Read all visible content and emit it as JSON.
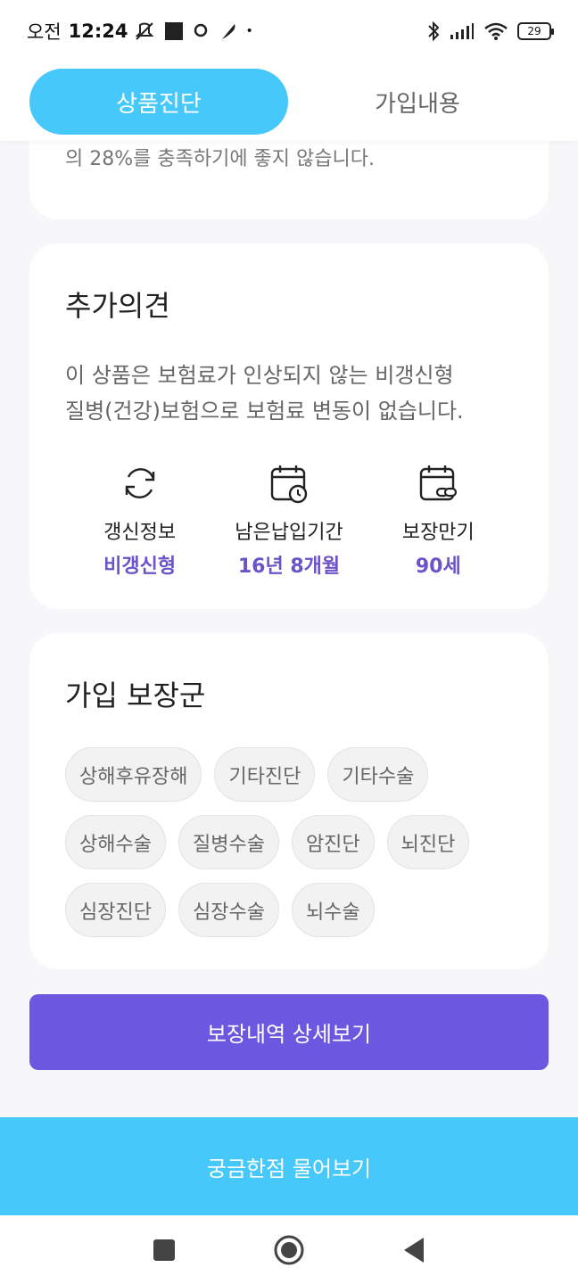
{
  "status_bar": {
    "ampm": "오전",
    "time": "12:24",
    "battery": "29"
  },
  "tabs": [
    {
      "label": "상품진단",
      "active": true
    },
    {
      "label": "가입내용",
      "active": false
    }
  ],
  "top_card": {
    "text": "의 28%를 충족하기에 좋지 않습니다."
  },
  "opinion": {
    "title": "추가의견",
    "desc_line1": "이 상품은 보험료가 인상되지 않는 비갱신형",
    "desc_line2": "질병(건강)보험으로 보험료 변동이 없습니다.",
    "items": [
      {
        "icon": "refresh-icon",
        "label": "갱신정보",
        "value": "비갱신형"
      },
      {
        "icon": "calendar-clock-icon",
        "label": "남은납입기간",
        "value": "16년 8개월"
      },
      {
        "icon": "calendar-link-icon",
        "label": "보장만기",
        "value": "90세"
      }
    ]
  },
  "coverage": {
    "title": "가입 보장군",
    "chips": [
      "상해후유장해",
      "기타진단",
      "기타수술",
      "상해수술",
      "질병수술",
      "암진단",
      "뇌진단",
      "심장진단",
      "심장수술",
      "뇌수술"
    ]
  },
  "detail_button": "보장내역 상세보기",
  "ask_button": "궁금한점 물어보기",
  "colors": {
    "accent_blue": "#46c8fb",
    "accent_purple": "#6b57e0",
    "value_purple": "#6a54c8"
  }
}
